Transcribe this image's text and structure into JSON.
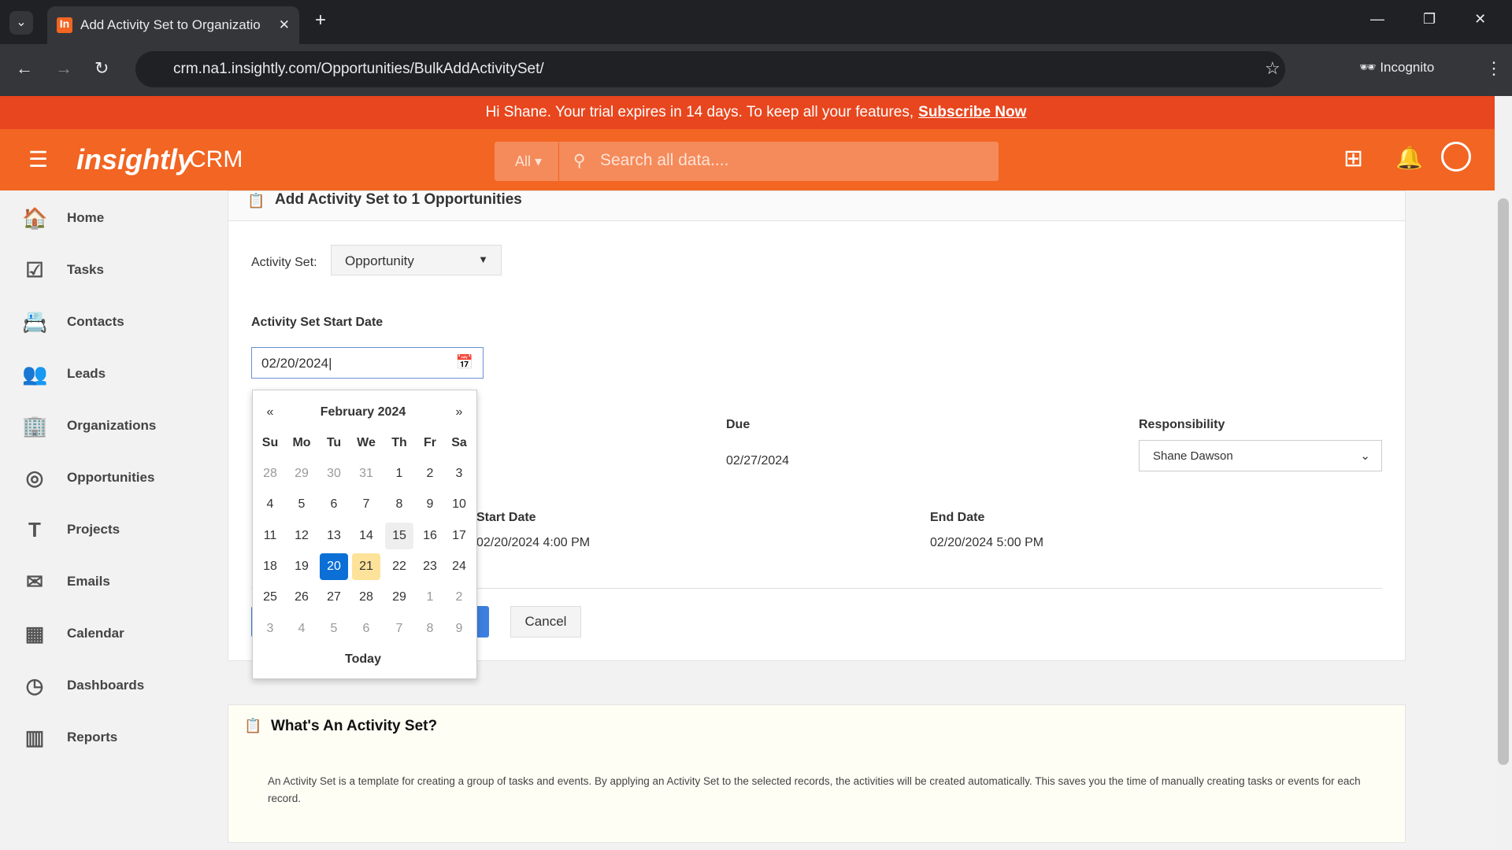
{
  "browser": {
    "tab_title": "Add Activity Set to Organizatio",
    "url": "crm.na1.insightly.com/Opportunities/BulkAddActivitySet/",
    "incognito": "Incognito"
  },
  "banner": {
    "text": "Hi Shane. Your trial expires in 14 days. To keep all your features,",
    "link": "Subscribe Now"
  },
  "header": {
    "logo": "insightly",
    "product": "CRM",
    "scope": "All",
    "search_placeholder": "Search all data...."
  },
  "sidebar": {
    "items": [
      {
        "label": "Home",
        "icon": "🏠"
      },
      {
        "label": "Tasks",
        "icon": "☑"
      },
      {
        "label": "Contacts",
        "icon": "📇"
      },
      {
        "label": "Leads",
        "icon": "👥"
      },
      {
        "label": "Organizations",
        "icon": "🏢"
      },
      {
        "label": "Opportunities",
        "icon": "◎"
      },
      {
        "label": "Projects",
        "icon": "T"
      },
      {
        "label": "Emails",
        "icon": "✉"
      },
      {
        "label": "Calendar",
        "icon": "▦"
      },
      {
        "label": "Dashboards",
        "icon": "◷"
      },
      {
        "label": "Reports",
        "icon": "▥"
      }
    ]
  },
  "form": {
    "title": "Add Activity Set to 1 Opportunities",
    "activity_set_label": "Activity Set:",
    "activity_set_value": "Opportunity",
    "start_date_label": "Activity Set Start Date",
    "start_date_value": "02/20/2024",
    "due_label": "Due",
    "due_value": "02/27/2024",
    "responsibility_label": "Responsibility",
    "responsibility_value": "Shane Dawson",
    "event_start_label": "Start Date",
    "event_start_value": "02/20/2024 4:00 PM",
    "event_end_label": "End Date",
    "event_end_value": "02/20/2024 5:00 PM",
    "cancel": "Cancel"
  },
  "calendar": {
    "month": "February 2024",
    "prev": "«",
    "next": "»",
    "weekdays": [
      "Su",
      "Mo",
      "Tu",
      "We",
      "Th",
      "Fr",
      "Sa"
    ],
    "weeks": [
      [
        "28",
        "29",
        "30",
        "31",
        "1",
        "2",
        "3"
      ],
      [
        "4",
        "5",
        "6",
        "7",
        "8",
        "9",
        "10"
      ],
      [
        "11",
        "12",
        "13",
        "14",
        "15",
        "16",
        "17"
      ],
      [
        "18",
        "19",
        "20",
        "21",
        "22",
        "23",
        "24"
      ],
      [
        "25",
        "26",
        "27",
        "28",
        "29",
        "1",
        "2"
      ],
      [
        "3",
        "4",
        "5",
        "6",
        "7",
        "8",
        "9"
      ]
    ],
    "selected": "20",
    "today": "21",
    "today_label": "Today",
    "colors": {
      "selected": "#0b6fd6",
      "today": "#fde29a"
    }
  },
  "help": {
    "title": "What's An Activity Set?",
    "text": "An Activity Set is a template for creating a group of tasks and events. By applying an Activity Set to the selected records, the activities will be created automatically. This saves you the time of manually creating tasks or events for each record."
  }
}
